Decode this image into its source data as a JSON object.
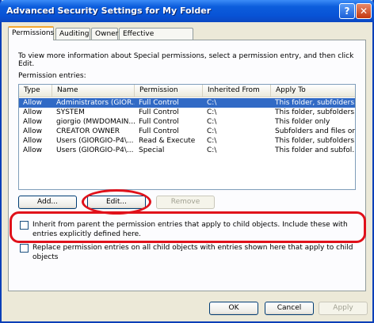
{
  "window": {
    "title": "Advanced Security Settings for My Folder",
    "help_glyph": "?",
    "close_glyph": "✕"
  },
  "tabs": [
    "Permissions",
    "Auditing",
    "Owner",
    "Effective Permissions"
  ],
  "permissions": {
    "info": "To view more information about Special permissions, select a permission entry, and then click Edit.",
    "entries_label": "Permission entries:",
    "columns": [
      "Type",
      "Name",
      "Permission",
      "Inherited From",
      "Apply To"
    ],
    "rows": [
      [
        "Allow",
        "Administrators (GIOR...",
        "Full Control",
        "C:\\",
        "This folder, subfolders..."
      ],
      [
        "Allow",
        "SYSTEM",
        "Full Control",
        "C:\\",
        "This folder, subfolders..."
      ],
      [
        "Allow",
        "giorgio (MWDOMAIN...",
        "Full Control",
        "C:\\",
        "This folder only"
      ],
      [
        "Allow",
        "CREATOR OWNER",
        "Full Control",
        "C:\\",
        "Subfolders and files only"
      ],
      [
        "Allow",
        "Users (GIORGIO-P4\\...",
        "Read & Execute",
        "C:\\",
        "This folder, subfolders..."
      ],
      [
        "Allow",
        "Users (GIORGIO-P4\\...",
        "Special",
        "C:\\",
        "This folder and subfol..."
      ]
    ],
    "selected_row": 0,
    "add_label": "Add...",
    "edit_label": "Edit...",
    "remove_label": "Remove",
    "inherit_label": "Inherit from parent the permission entries that apply to child objects. Include these with entries explicitly defined here.",
    "replace_label": "Replace permission entries on all child objects with entries shown here that apply to child objects"
  },
  "footer": {
    "ok_label": "OK",
    "cancel_label": "Cancel",
    "apply_label": "Apply"
  },
  "colors": {
    "title_bar": "#0853d6",
    "selection": "#316ac5",
    "highlight_oval": "#e0111a"
  }
}
